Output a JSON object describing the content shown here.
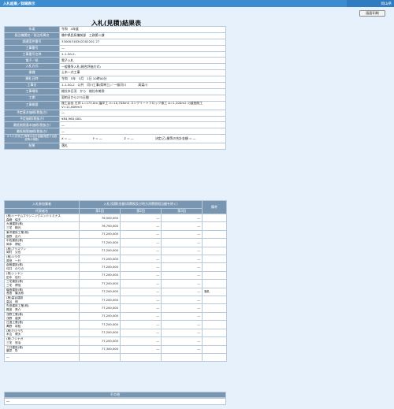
{
  "topbar": {
    "breadcrumb": "入札結果／詳細表示",
    "right_label": "岡山県"
  },
  "print_button": "画面印刷",
  "page_title": "入札(見積)結果表",
  "info": [
    {
      "key": "年度",
      "value": "令和　4年度"
    },
    {
      "key": "発注機関名／発注所属名",
      "value": "備中県民局備前部　工務第二課"
    },
    {
      "key": "調達案件番号",
      "value": "33000316342202201 27"
    },
    {
      "key": "工事番号",
      "value": "―"
    },
    {
      "key": "工事番号名称",
      "value": "1-1-50-2-"
    },
    {
      "key": "電子／紙",
      "value": "電子入札"
    },
    {
      "key": "入札方式",
      "value": "一般競争入札(総合評価方式)"
    },
    {
      "key": "業種",
      "value": "土木一式工事"
    },
    {
      "key": "開札日時",
      "value": "令和　5年　3月　1日 10時00分"
    },
    {
      "key": "工事名",
      "value": "1-1-50-2　公共　河川工事(県単工)／一級河川　　　　高梁川"
    },
    {
      "key": "工事場所",
      "value": "総社市日羽　から　総社市美袋"
    },
    {
      "key": "工期",
      "value": "契約日から275日間"
    },
    {
      "key": "工事概要",
      "value": "施工延長 左岸 L=175.0m 護岸工 V=10,708m3 コンクリートブロック積工 A=1,200m2 河道掘削工 V=11,609m3"
    },
    {
      "key": "予定基本価格(税抜き)",
      "value": "―"
    },
    {
      "key": "予定価格(税抜き)",
      "value": "¥84,960,000-"
    },
    {
      "key": "最低制限基本価格(税抜き)",
      "value": "―"
    },
    {
      "key": "最低制限価格(税抜き)",
      "value": "―"
    },
    {
      "key": "X,Y,Z,次決(乙)等等の合計金額(随意する経緯等の係数)",
      "value_x": "X = ―",
      "value_y": "Y = ―",
      "value_z": "Z = ―",
      "value_w": "決定(乙)業等の合計金額 = ―"
    },
    {
      "key": "結果",
      "value": "落札"
    }
  ],
  "bids": {
    "header_name": "入札参加業者",
    "header_amount": "入札(見積)金額(消費税及び地方消費税相当額を除く)",
    "header_note": "備考",
    "sub_name": "代表者名",
    "sub_rounds": [
      "第1回",
      "第2回",
      "第3回"
    ],
    "rows": [
      {
        "name1": "(株)トーテムプランニングエンドリミナス",
        "name2": "森嶋　保夫",
        "r1": "76,500,000",
        "r2": "―",
        "r3": "―",
        "note": ""
      },
      {
        "name1": "大浦建設(株)",
        "name2": "三宅　精光",
        "r1": "76,700,000",
        "r2": "―",
        "r3": "―",
        "note": ""
      },
      {
        "name1": "東洋建設工業(株)",
        "name2": "高野　吉介",
        "r1": "77,200,000",
        "r2": "―",
        "r3": "―",
        "note": ""
      },
      {
        "name1": "中佐建設(株)",
        "name2": "岡本　博紀",
        "r1": "77,200,000",
        "r2": "―",
        "r3": "―",
        "note": ""
      },
      {
        "name1": "(株)プラスワン",
        "name2": "岡村　公也",
        "r1": "77,200,000",
        "r2": "―",
        "r3": "―",
        "note": ""
      },
      {
        "name1": "(株)ハラダ",
        "name2": "原田　一行",
        "r1": "77,200,000",
        "r2": "―",
        "r3": "―",
        "note": ""
      },
      {
        "name1": "倉敷建設(株)",
        "name2": "坪井　のりの",
        "r1": "77,200,000",
        "r2": "―",
        "r3": "―",
        "note": ""
      },
      {
        "name1": "(株)シンヤン",
        "name2": "田中　信行",
        "r1": "77,200,000",
        "r2": "―",
        "r3": "―",
        "note": ""
      },
      {
        "name1": "三宅建設(株)",
        "name2": "三宅　博信",
        "r1": "77,200,000",
        "r2": "―",
        "r3": "―",
        "note": ""
      },
      {
        "name1": "磯島建設(株)",
        "name2": "長島　隆太郎",
        "r1": "77,200,000",
        "r2": "―",
        "r3": "―",
        "note": "落札"
      },
      {
        "name1": "(株)高谷建設",
        "name2": "高谷　明",
        "r1": "77,200,000",
        "r2": "―",
        "r3": "―",
        "note": ""
      },
      {
        "name1": "先田建設工業(株)",
        "name2": "梶波　亮介",
        "r1": "77,200,000",
        "r2": "―",
        "r3": "―",
        "note": ""
      },
      {
        "name1": "浅野工業(株)",
        "name2": "浅野　道男",
        "r1": "77,200,000",
        "r2": "―",
        "r3": "―",
        "note": ""
      },
      {
        "name1": "日進工業(株)",
        "name2": "萬野　将知",
        "r1": "77,200,000",
        "r2": "―",
        "r3": "―",
        "note": ""
      },
      {
        "name1": "(株)たけうち",
        "name2": "木山　健太",
        "r1": "77,200,000",
        "r2": "―",
        "r3": "―",
        "note": ""
      },
      {
        "name1": "(株)フジナガ",
        "name2": "三宅　悠治",
        "r1": "77,200,000",
        "r2": "―",
        "r3": "―",
        "note": ""
      },
      {
        "name1": "三井建設(株)",
        "name2": "葉見　彰",
        "r1": "77,300,000",
        "r2": "―",
        "r3": "―",
        "note": ""
      }
    ],
    "empty_row": "―"
  },
  "other": {
    "header": "その他",
    "value": "―"
  }
}
